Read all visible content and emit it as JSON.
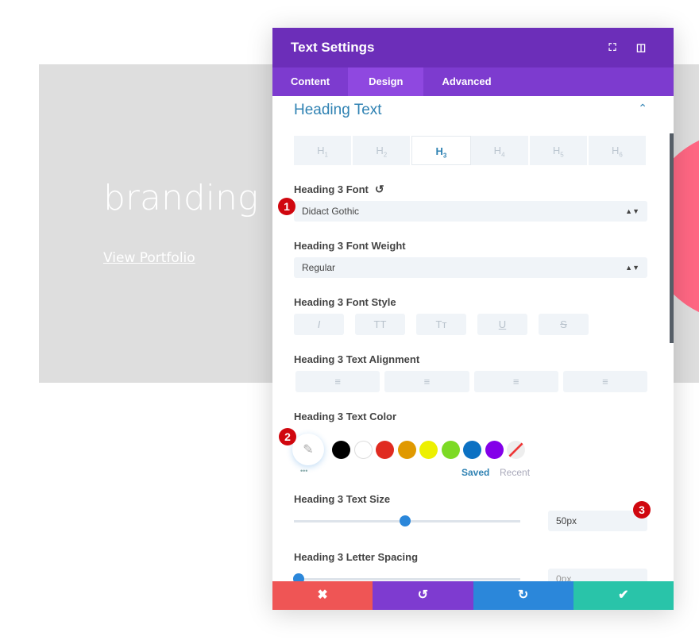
{
  "background": {
    "heading": "branding",
    "link": "View Portfolio",
    "accent_circle": "#ff6783"
  },
  "modal": {
    "title": "Text Settings",
    "header_icons": [
      "fullscreen-icon",
      "sidebar-icon"
    ],
    "tabs": [
      {
        "label": "Content"
      },
      {
        "label": "Design",
        "active": true
      },
      {
        "label": "Advanced"
      }
    ],
    "section": {
      "title": "Heading Text",
      "expanded": true
    },
    "heading_levels": [
      {
        "label": "H",
        "sub": "1"
      },
      {
        "label": "H",
        "sub": "2"
      },
      {
        "label": "H",
        "sub": "3",
        "active": true
      },
      {
        "label": "H",
        "sub": "4"
      },
      {
        "label": "H",
        "sub": "5"
      },
      {
        "label": "H",
        "sub": "6"
      }
    ],
    "font": {
      "label": "Heading 3 Font",
      "value": "Didact Gothic"
    },
    "weight": {
      "label": "Heading 3 Font Weight",
      "value": "Regular"
    },
    "style": {
      "label": "Heading 3 Font Style",
      "buttons": [
        "I",
        "TT",
        "Tт",
        "U",
        "S"
      ]
    },
    "alignment": {
      "label": "Heading 3 Text Alignment",
      "options": [
        "left",
        "center",
        "right",
        "justify"
      ]
    },
    "color": {
      "label": "Heading 3 Text Color",
      "swatches": [
        "#000000",
        "#ffffff",
        "#e02b20",
        "#e09900",
        "#edf000",
        "#7cda24",
        "#0c71c3",
        "#8300e9"
      ],
      "saved": "Saved",
      "recent": "Recent",
      "more": "•••"
    },
    "size": {
      "label": "Heading 3 Text Size",
      "value": "50px",
      "slider_fraction": 0.49
    },
    "spacing": {
      "label": "Heading 3 Letter Spacing",
      "value": "0px",
      "slider_fraction": 0.02
    },
    "footer": [
      {
        "name": "cancel",
        "icon": "✖",
        "color": "#ef5555"
      },
      {
        "name": "undo",
        "icon": "↺",
        "color": "#7e3bd0"
      },
      {
        "name": "redo",
        "icon": "↻",
        "color": "#2b87da"
      },
      {
        "name": "save",
        "icon": "✔",
        "color": "#29c4a9"
      }
    ]
  },
  "badges": [
    "1",
    "2",
    "3"
  ]
}
